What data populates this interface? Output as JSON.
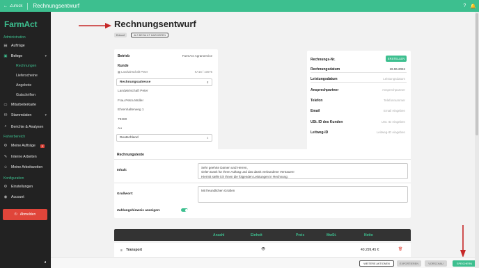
{
  "topbar": {
    "back_label": "Zurück",
    "title": "Rechnungsentwurf",
    "help_icon": "help-icon",
    "bell_icon": "bell-icon"
  },
  "sidebar": {
    "brand": "FarmAct",
    "section_admin": "Administration",
    "orders": "Aufträge",
    "receipts": "Belege",
    "sub_invoices": "Rechnungen",
    "sub_delivery": "Lieferscheine",
    "sub_offers": "Angebote",
    "sub_credits": "Gutschriften",
    "employee_cards": "Mitarbeiterkarte",
    "master_data": "Stammdaten",
    "reports": "Berichte & Analysen",
    "section_driver": "Fahrerbereich",
    "my_orders": "Meine Aufträge",
    "my_orders_badge": "2",
    "internal_work": "Interne Arbeiten",
    "my_work": "Meine Arbeitszeiten",
    "section_config": "Konfiguration",
    "settings": "Einstellungen",
    "account": "Account",
    "logout": "Abmelden"
  },
  "page": {
    "title": "Rechnungsentwurf",
    "status_chip": "Entwurf",
    "mark_paid_chip": "ALS BEZAHLT MARKIEREN"
  },
  "customer": {
    "company_label": "Betrieb",
    "company_value": "FarmAct Agrarservice",
    "customer_label": "Kunde",
    "customer_name": "Landwirtschaft Peter",
    "customer_no": "KA16 / 10075",
    "address_dropdown": "Rechnungsadresse",
    "addr_line1": "Landwirtschaft Peter",
    "addr_line2": "Frau Petra Müller",
    "addr_line3": "Ehrenhalterweg 1",
    "addr_line4": "79280",
    "addr_line5": "Au",
    "country_select": "Deutschland"
  },
  "invoice_meta": {
    "number_label": "Rechnungs-Nr.",
    "create_button": "ERSTELLEN",
    "date_label": "Rechnungsdatum",
    "date_value": "19.06.2024",
    "service_date_label": "Leistungsdatum",
    "service_date_placeholder": "Leistungsdatum",
    "contact_label": "Ansprechpartner",
    "contact_placeholder": "Ansprechpartner",
    "phone_label": "Telefon",
    "phone_placeholder": "Telefonnummer",
    "email_label": "Email",
    "email_placeholder": "Email eingeben",
    "vat_label": "USt. ID des Kunden",
    "vat_placeholder": "USt. ID eingeben",
    "leitweg_label": "Leitweg-ID",
    "leitweg_placeholder": "Leitweg-ID eingeben"
  },
  "texts": {
    "section_title": "Rechnungstexte",
    "intro_label": "Inhalt:",
    "intro_line1": "Sehr geehrte Damen und Herren,",
    "intro_line2": "vielen Dank für Ihren Auftrag und das damit verbundene Vertrauen!",
    "intro_line3": "Hiermit stelle ich Ihnen die folgenden Leistungen in Rechnung:",
    "closing_label": "Grußwort:",
    "closing_value": "Mit freundlichen Grüßen",
    "payment_hint_label": "Zahlungshinweis anzeigen:"
  },
  "table": {
    "headers": [
      "Anzahl",
      "Einheit",
      "Preis",
      "MwSt.",
      "Netto"
    ],
    "row_name": "Transport",
    "row_netto": "40.299,45 €"
  },
  "footer": {
    "more_actions": "WEITERE AKTIONEN",
    "export": "EXPORTIEREN",
    "preview": "VORSCHAU",
    "save": "SPEICHERN"
  },
  "colors": {
    "accent": "#3dbf8f",
    "danger": "#e0453a",
    "sidebar": "#222222",
    "annotation_arrow": "#c62828"
  }
}
